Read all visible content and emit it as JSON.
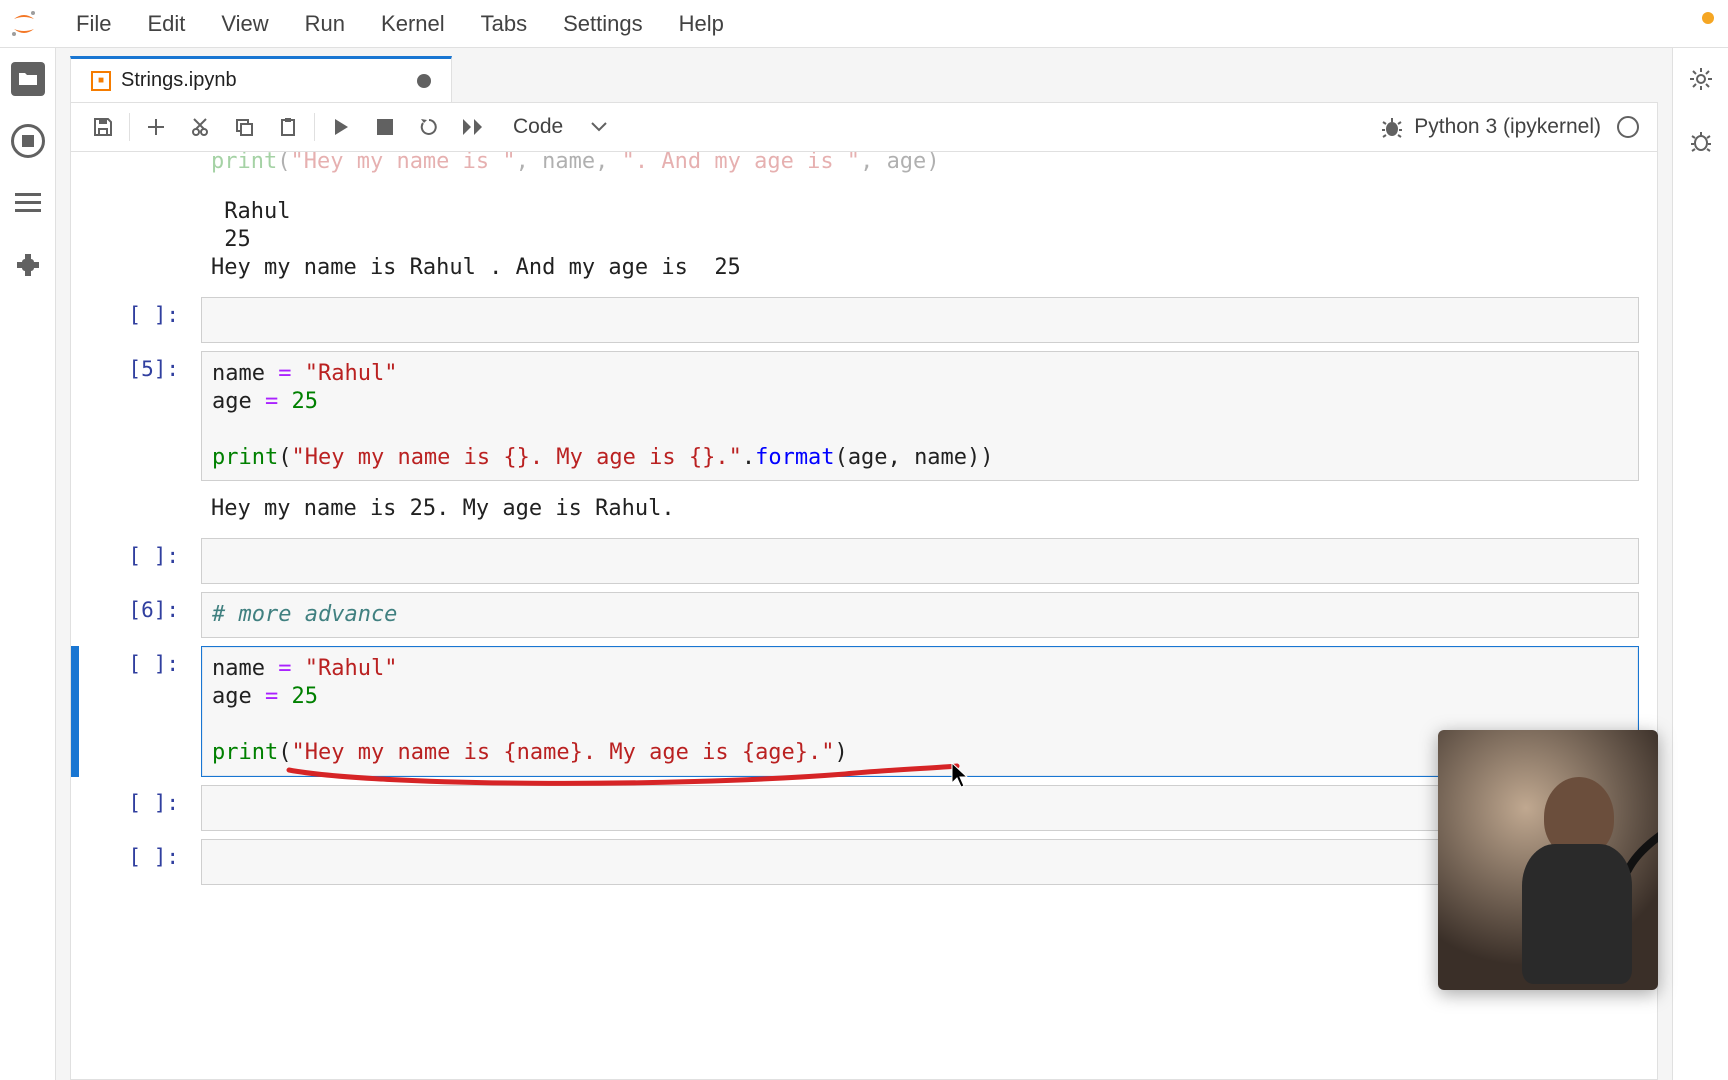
{
  "menubar": {
    "items": [
      "File",
      "Edit",
      "View",
      "Run",
      "Kernel",
      "Tabs",
      "Settings",
      "Help"
    ]
  },
  "activitybar": {
    "icons": [
      "folder-icon",
      "running-icon",
      "toc-icon",
      "extensions-icon"
    ]
  },
  "rightbar": {
    "icons": [
      "gear-icon",
      "debug-icon"
    ]
  },
  "tab": {
    "title": "Strings.ipynb",
    "dirty": true
  },
  "toolbar": {
    "cell_type": "Code",
    "kernel_label": "Python 3 (ipykernel)"
  },
  "cells": [
    {
      "kind": "code-cutoff",
      "prompt": "",
      "code_tokens": [
        {
          "cls": "tok-builtin faded",
          "t": "print"
        },
        {
          "cls": "faded",
          "t": "("
        },
        {
          "cls": "tok-str faded",
          "t": "\"Hey my name is \""
        },
        {
          "cls": "faded",
          "t": ", "
        },
        {
          "cls": "tok-name faded",
          "t": "name"
        },
        {
          "cls": "faded",
          "t": ", "
        },
        {
          "cls": "tok-str faded",
          "t": "\". And my age is \""
        },
        {
          "cls": "faded",
          "t": ", "
        },
        {
          "cls": "tok-name faded",
          "t": "age"
        },
        {
          "cls": "faded",
          "t": ")"
        }
      ]
    },
    {
      "kind": "output",
      "text": " Rahul\n 25\nHey my name is Rahul . And my age is  25"
    },
    {
      "kind": "code",
      "prompt": "[ ]:",
      "code_tokens": []
    },
    {
      "kind": "code",
      "prompt": "[5]:",
      "code_tokens": [
        {
          "cls": "tok-name",
          "t": "name"
        },
        {
          "cls": "",
          "t": " "
        },
        {
          "cls": "tok-op",
          "t": "="
        },
        {
          "cls": "",
          "t": " "
        },
        {
          "cls": "tok-str",
          "t": "\"Rahul\""
        },
        {
          "cls": "",
          "t": "\n"
        },
        {
          "cls": "tok-name",
          "t": "age"
        },
        {
          "cls": "",
          "t": " "
        },
        {
          "cls": "tok-op",
          "t": "="
        },
        {
          "cls": "",
          "t": " "
        },
        {
          "cls": "tok-num",
          "t": "25"
        },
        {
          "cls": "",
          "t": "\n\n"
        },
        {
          "cls": "tok-builtin",
          "t": "print"
        },
        {
          "cls": "",
          "t": "("
        },
        {
          "cls": "tok-str",
          "t": "\"Hey my name is {}. My age is {}.\""
        },
        {
          "cls": "",
          "t": "."
        },
        {
          "cls": "tok-method",
          "t": "format"
        },
        {
          "cls": "",
          "t": "("
        },
        {
          "cls": "tok-name",
          "t": "age"
        },
        {
          "cls": "",
          "t": ", "
        },
        {
          "cls": "tok-name",
          "t": "name"
        },
        {
          "cls": "",
          "t": "))"
        }
      ]
    },
    {
      "kind": "output",
      "text": "Hey my name is 25. My age is Rahul."
    },
    {
      "kind": "code",
      "prompt": "[ ]:",
      "code_tokens": []
    },
    {
      "kind": "code",
      "prompt": "[6]:",
      "code_tokens": [
        {
          "cls": "tok-comment",
          "t": "# more advance"
        }
      ]
    },
    {
      "kind": "code",
      "prompt": "[ ]:",
      "active": true,
      "code_tokens": [
        {
          "cls": "tok-name",
          "t": "name"
        },
        {
          "cls": "",
          "t": " "
        },
        {
          "cls": "tok-op",
          "t": "="
        },
        {
          "cls": "",
          "t": " "
        },
        {
          "cls": "tok-str",
          "t": "\"Rahul\""
        },
        {
          "cls": "",
          "t": "\n"
        },
        {
          "cls": "tok-name",
          "t": "age"
        },
        {
          "cls": "",
          "t": " "
        },
        {
          "cls": "tok-op",
          "t": "="
        },
        {
          "cls": "",
          "t": " "
        },
        {
          "cls": "tok-num",
          "t": "25"
        },
        {
          "cls": "",
          "t": "\n\n"
        },
        {
          "cls": "tok-builtin",
          "t": "print"
        },
        {
          "cls": "",
          "t": "("
        },
        {
          "cls": "tok-str",
          "t": "\"Hey my name is {name}. My age is {age}.\""
        },
        {
          "cls": "",
          "t": ")"
        }
      ]
    },
    {
      "kind": "code",
      "prompt": "[ ]:",
      "code_tokens": []
    },
    {
      "kind": "code",
      "prompt": "[ ]:",
      "code_tokens": []
    }
  ]
}
